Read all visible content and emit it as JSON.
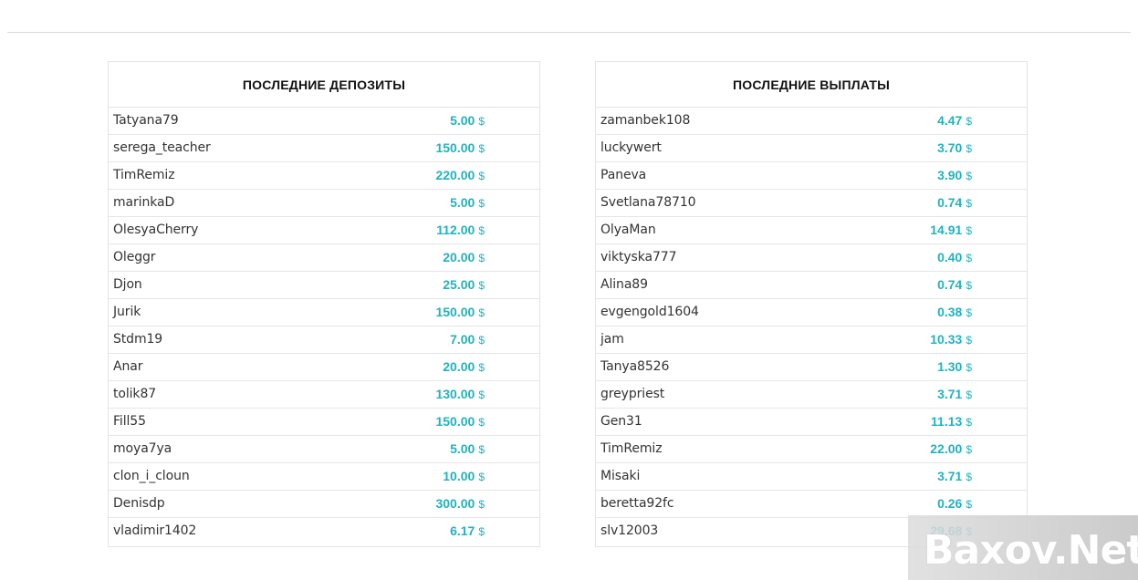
{
  "deposits": {
    "title": "ПОСЛЕДНИЕ ДЕПОЗИТЫ",
    "rows": [
      {
        "name": "Tatyana79",
        "amount": "5.00",
        "currency": "$"
      },
      {
        "name": "serega_teacher",
        "amount": "150.00",
        "currency": "$"
      },
      {
        "name": "TimRemiz",
        "amount": "220.00",
        "currency": "$"
      },
      {
        "name": "marinkaD",
        "amount": "5.00",
        "currency": "$"
      },
      {
        "name": "OlesyaCherry",
        "amount": "112.00",
        "currency": "$"
      },
      {
        "name": "Oleggr",
        "amount": "20.00",
        "currency": "$"
      },
      {
        "name": "Djon",
        "amount": "25.00",
        "currency": "$"
      },
      {
        "name": "Jurik",
        "amount": "150.00",
        "currency": "$"
      },
      {
        "name": "Stdm19",
        "amount": "7.00",
        "currency": "$"
      },
      {
        "name": "Anar",
        "amount": "20.00",
        "currency": "$"
      },
      {
        "name": "tolik87",
        "amount": "130.00",
        "currency": "$"
      },
      {
        "name": "Fill55",
        "amount": "150.00",
        "currency": "$"
      },
      {
        "name": "moya7ya",
        "amount": "5.00",
        "currency": "$"
      },
      {
        "name": "clon_i_cloun",
        "amount": "10.00",
        "currency": "$"
      },
      {
        "name": "Denisdp",
        "amount": "300.00",
        "currency": "$"
      },
      {
        "name": "vladimir1402",
        "amount": "6.17",
        "currency": "$"
      }
    ]
  },
  "payouts": {
    "title": "ПОСЛЕДНИЕ ВЫПЛАТЫ",
    "rows": [
      {
        "name": "zamanbek108",
        "amount": "4.47",
        "currency": "$"
      },
      {
        "name": "luckywert",
        "amount": "3.70",
        "currency": "$"
      },
      {
        "name": "Paneva",
        "amount": "3.90",
        "currency": "$"
      },
      {
        "name": "Svetlana78710",
        "amount": "0.74",
        "currency": "$"
      },
      {
        "name": "OlyaMan",
        "amount": "14.91",
        "currency": "$"
      },
      {
        "name": "viktyska777",
        "amount": "0.40",
        "currency": "$"
      },
      {
        "name": "Alina89",
        "amount": "0.74",
        "currency": "$"
      },
      {
        "name": "evgengold1604",
        "amount": "0.38",
        "currency": "$"
      },
      {
        "name": "jam",
        "amount": "10.33",
        "currency": "$"
      },
      {
        "name": "Tanya8526",
        "amount": "1.30",
        "currency": "$"
      },
      {
        "name": "greypriest",
        "amount": "3.71",
        "currency": "$"
      },
      {
        "name": "Gen31",
        "amount": "11.13",
        "currency": "$"
      },
      {
        "name": "TimRemiz",
        "amount": "22.00",
        "currency": "$"
      },
      {
        "name": "Misaki",
        "amount": "3.71",
        "currency": "$"
      },
      {
        "name": "beretta92fc",
        "amount": "0.26",
        "currency": "$"
      },
      {
        "name": "slv12003",
        "amount": "29.68",
        "currency": "$"
      }
    ]
  },
  "watermark": {
    "text": "Baxov.Net"
  },
  "colors": {
    "accent": "#1fb3c0",
    "border": "#e4e4e4",
    "text": "#333333"
  }
}
